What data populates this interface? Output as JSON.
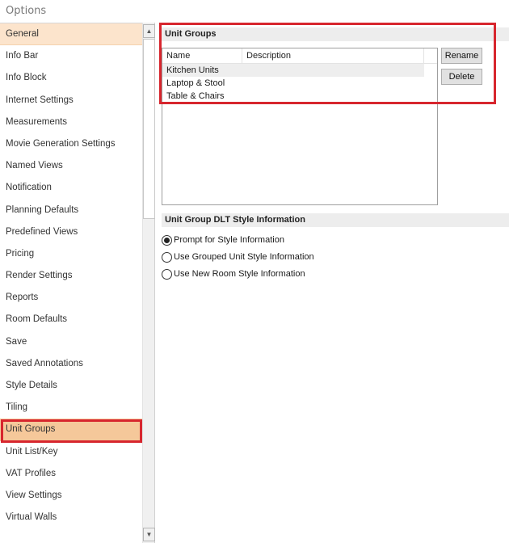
{
  "window": {
    "title": "Options"
  },
  "sidebar": {
    "items": [
      {
        "label": "General"
      },
      {
        "label": "Info Bar"
      },
      {
        "label": "Info Block"
      },
      {
        "label": "Internet Settings"
      },
      {
        "label": "Measurements"
      },
      {
        "label": "Movie Generation Settings"
      },
      {
        "label": "Named Views"
      },
      {
        "label": "Notification"
      },
      {
        "label": "Planning Defaults"
      },
      {
        "label": "Predefined Views"
      },
      {
        "label": "Pricing"
      },
      {
        "label": "Render Settings"
      },
      {
        "label": "Reports"
      },
      {
        "label": "Room Defaults"
      },
      {
        "label": "Save"
      },
      {
        "label": "Saved Annotations"
      },
      {
        "label": "Style Details"
      },
      {
        "label": "Tiling"
      },
      {
        "label": "Unit Groups"
      },
      {
        "label": "Unit List/Key"
      },
      {
        "label": "VAT Profiles"
      },
      {
        "label": "View Settings"
      },
      {
        "label": "Virtual Walls"
      }
    ],
    "selected": "Unit Groups"
  },
  "unit_groups": {
    "header": "Unit Groups",
    "columns": [
      "Name",
      "Description"
    ],
    "rows": [
      {
        "name": "Kitchen Units",
        "description": ""
      },
      {
        "name": "Laptop & Stool",
        "description": ""
      },
      {
        "name": "Table & Chairs",
        "description": ""
      }
    ],
    "rename_label": "Rename",
    "delete_label": "Delete"
  },
  "dlt_style": {
    "header": "Unit Group DLT Style Information",
    "options": [
      {
        "label": "Prompt for Style Information",
        "checked": true
      },
      {
        "label": "Use Grouped Unit Style Information",
        "checked": false
      },
      {
        "label": "Use New Room Style Information",
        "checked": false
      }
    ]
  },
  "colors": {
    "selection_highlight": "#f5c89a",
    "annotation_red": "#d7262e"
  }
}
